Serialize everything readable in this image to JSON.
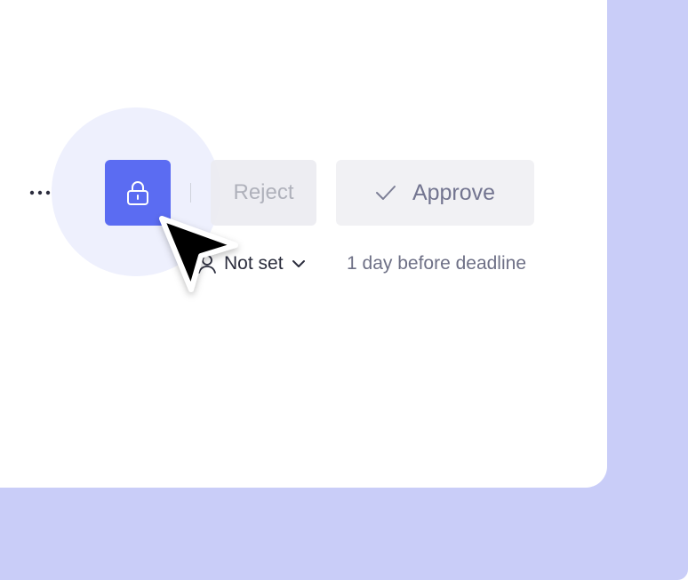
{
  "toolbar": {
    "more_icon": "more-horizontal-icon",
    "lock_icon": "lock-icon",
    "reject_label": "Reject",
    "approve_label": "Approve",
    "approve_icon": "checkmark-icon"
  },
  "meta": {
    "assignee_icon": "user-icon",
    "assignee_value": "Not set",
    "assignee_dropdown_icon": "chevron-down-icon",
    "deadline_text": "1 day before deadline"
  },
  "colors": {
    "accent": "#5b6cf2",
    "backdrop": "#c9cdf8",
    "halo": "#eef0fd"
  }
}
